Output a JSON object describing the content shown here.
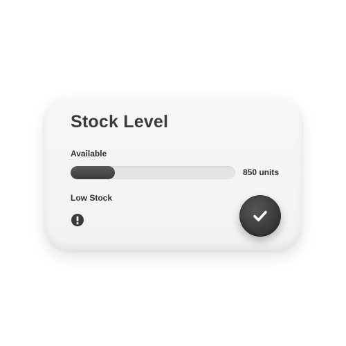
{
  "card": {
    "title": "Stock Level",
    "available_label": "Available",
    "available_progress": 0.27,
    "available_value": "850 units",
    "low_stock_label": "Low Stock",
    "warning_icon": "exclamation-circle-icon",
    "confirm_icon": "checkmark-icon"
  },
  "colors": {
    "card_background": "#f4f4f4",
    "accent_dark": "#3c3c3c",
    "track": "#e4e4e4",
    "text": "#3a3a3a"
  }
}
